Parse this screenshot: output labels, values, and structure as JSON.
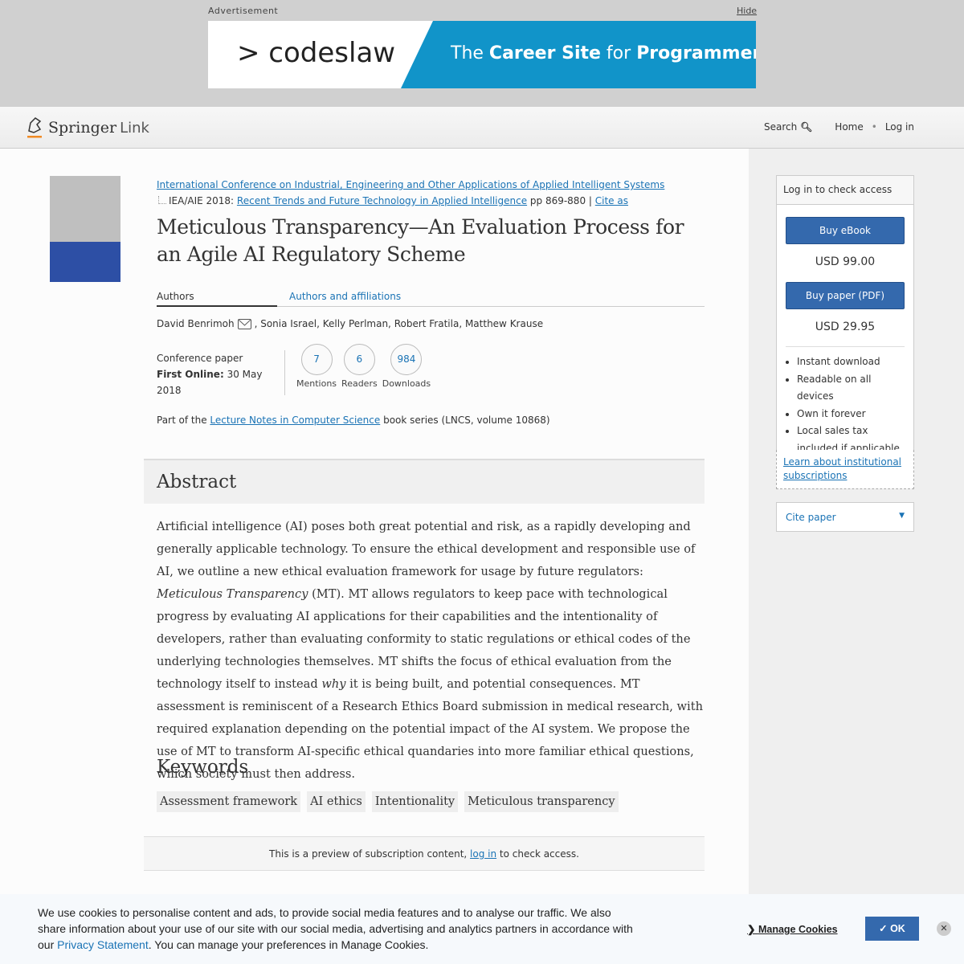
{
  "ad": {
    "label": "Advertisement",
    "hide": "Hide",
    "logo": "> codeslaw",
    "tag_pre": "The ",
    "tag_b1": "Career Site",
    "tag_mid": " for ",
    "tag_b2": "Programmers"
  },
  "header": {
    "logo": "Springer",
    "logo2": "Link",
    "nav": {
      "search": "Search",
      "home": "Home",
      "login": "Log in"
    }
  },
  "breadcrumb": {
    "conference": "International Conference on Industrial, Engineering and Other Applications of Applied Intelligent Systems",
    "prefix": "IEA/AIE 2018: ",
    "book": "Recent Trends and Future Technology in Applied Intelligence",
    "pages": " pp 869-880 | ",
    "cite": "Cite as"
  },
  "title": "Meticulous Transparency—An Evaluation Process for an Agile AI Regulatory Scheme",
  "tabs": {
    "authors": "Authors",
    "affiliations": "Authors and affiliations"
  },
  "authors": {
    "first": "David Benrimoh",
    "rest": ", Sonia Israel, Kelly Perlman, Robert Fratila, Matthew Krause"
  },
  "meta": {
    "type": "Conference paper",
    "first_online_label": "First Online:",
    "first_online": " 30 May 2018"
  },
  "metrics": [
    {
      "value": "7",
      "label": "Mentions"
    },
    {
      "value": "6",
      "label": "Readers"
    },
    {
      "value": "984",
      "label": "Downloads"
    }
  ],
  "series": {
    "pre": "Part of the ",
    "link": "Lecture Notes in Computer Science",
    "post": " book series (LNCS, volume 10868)"
  },
  "abstract": {
    "heading": "Abstract",
    "p1": "Artificial intelligence (AI) poses both great potential and risk, as a rapidly developing and generally applicable technology. To ensure the ethical development and responsible use of AI, we outline a new ethical evaluation framework for usage by future regulators: ",
    "em1": "Meticulous Transparency",
    "p2": " (MT). MT allows regulators to keep pace with technological progress by evaluating AI applications for their capabilities and the intentionality of developers, rather than evaluating conformity to static regulations or ethical codes of the underlying technologies themselves. MT shifts the focus of ethical evaluation from the technology itself to instead ",
    "em2": "why",
    "p3": " it is being built, and potential consequences. MT assessment is reminiscent of a Research Ethics Board submission in medical research, with required explanation depending on the potential impact of the AI system. We propose the use of MT to transform AI-specific ethical quandaries into more familiar ethical questions, which society must then address."
  },
  "keywords": {
    "heading": "Keywords",
    "items": [
      "Assessment framework",
      "AI ethics",
      "Intentionality",
      "Meticulous transparency"
    ]
  },
  "preview": {
    "pre": "This is a preview of subscription content, ",
    "link": "log in",
    "post": " to check access."
  },
  "buybox": {
    "header": "Log in to check access",
    "ebook": "Buy eBook",
    "ebook_price": "USD 99.00",
    "paper": "Buy paper (PDF)",
    "paper_price": "USD 29.95",
    "bullets": [
      "Instant download",
      "Readable on all devices",
      "Own it forever",
      "Local sales tax included if applicable"
    ],
    "institutional": "Learn about institutional subscriptions",
    "cite": "Cite paper"
  },
  "cookie": {
    "text1": "We use cookies to personalise content and ads, to provide social media features and to analyse our traffic. We also share information about your use of our site with our social media, advertising and analytics partners in accordance with our ",
    "link": "Privacy Statement",
    "text2": ". You can manage your preferences in Manage Cookies.",
    "manage": "Manage Cookies",
    "ok": "✓ OK",
    "close": "✕"
  }
}
